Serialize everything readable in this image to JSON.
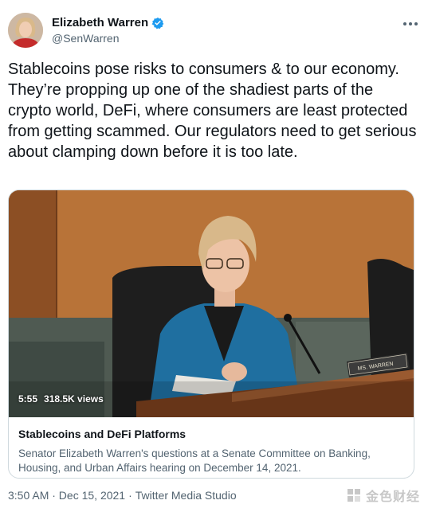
{
  "author": {
    "name": "Elizabeth Warren",
    "handle": "@SenWarren",
    "verified": true
  },
  "tweet": {
    "text": "Stablecoins pose risks to consumers & to our economy. They’re propping up one of the shadiest parts of the crypto world, DeFi, where consumers are least protected from getting scammed. Our regulators need to get serious about clamping down before it is too late."
  },
  "media": {
    "duration": "5:55",
    "views": "318.5K views",
    "nameplate": "MS. WARREN",
    "title": "Stablecoins and DeFi Platforms",
    "description": "Senator Elizabeth Warren's questions at a Senate Committee on Banking, Housing, and Urban Affairs hearing on December 14, 2021."
  },
  "footer": {
    "timestamp": "3:50 AM · Dec 15, 2021",
    "separator": "·",
    "source": "Twitter Media Studio"
  },
  "watermark": {
    "text": "金色财经"
  },
  "colors": {
    "verified_blue": "#1d9bf0",
    "secondary_text": "#536471"
  }
}
